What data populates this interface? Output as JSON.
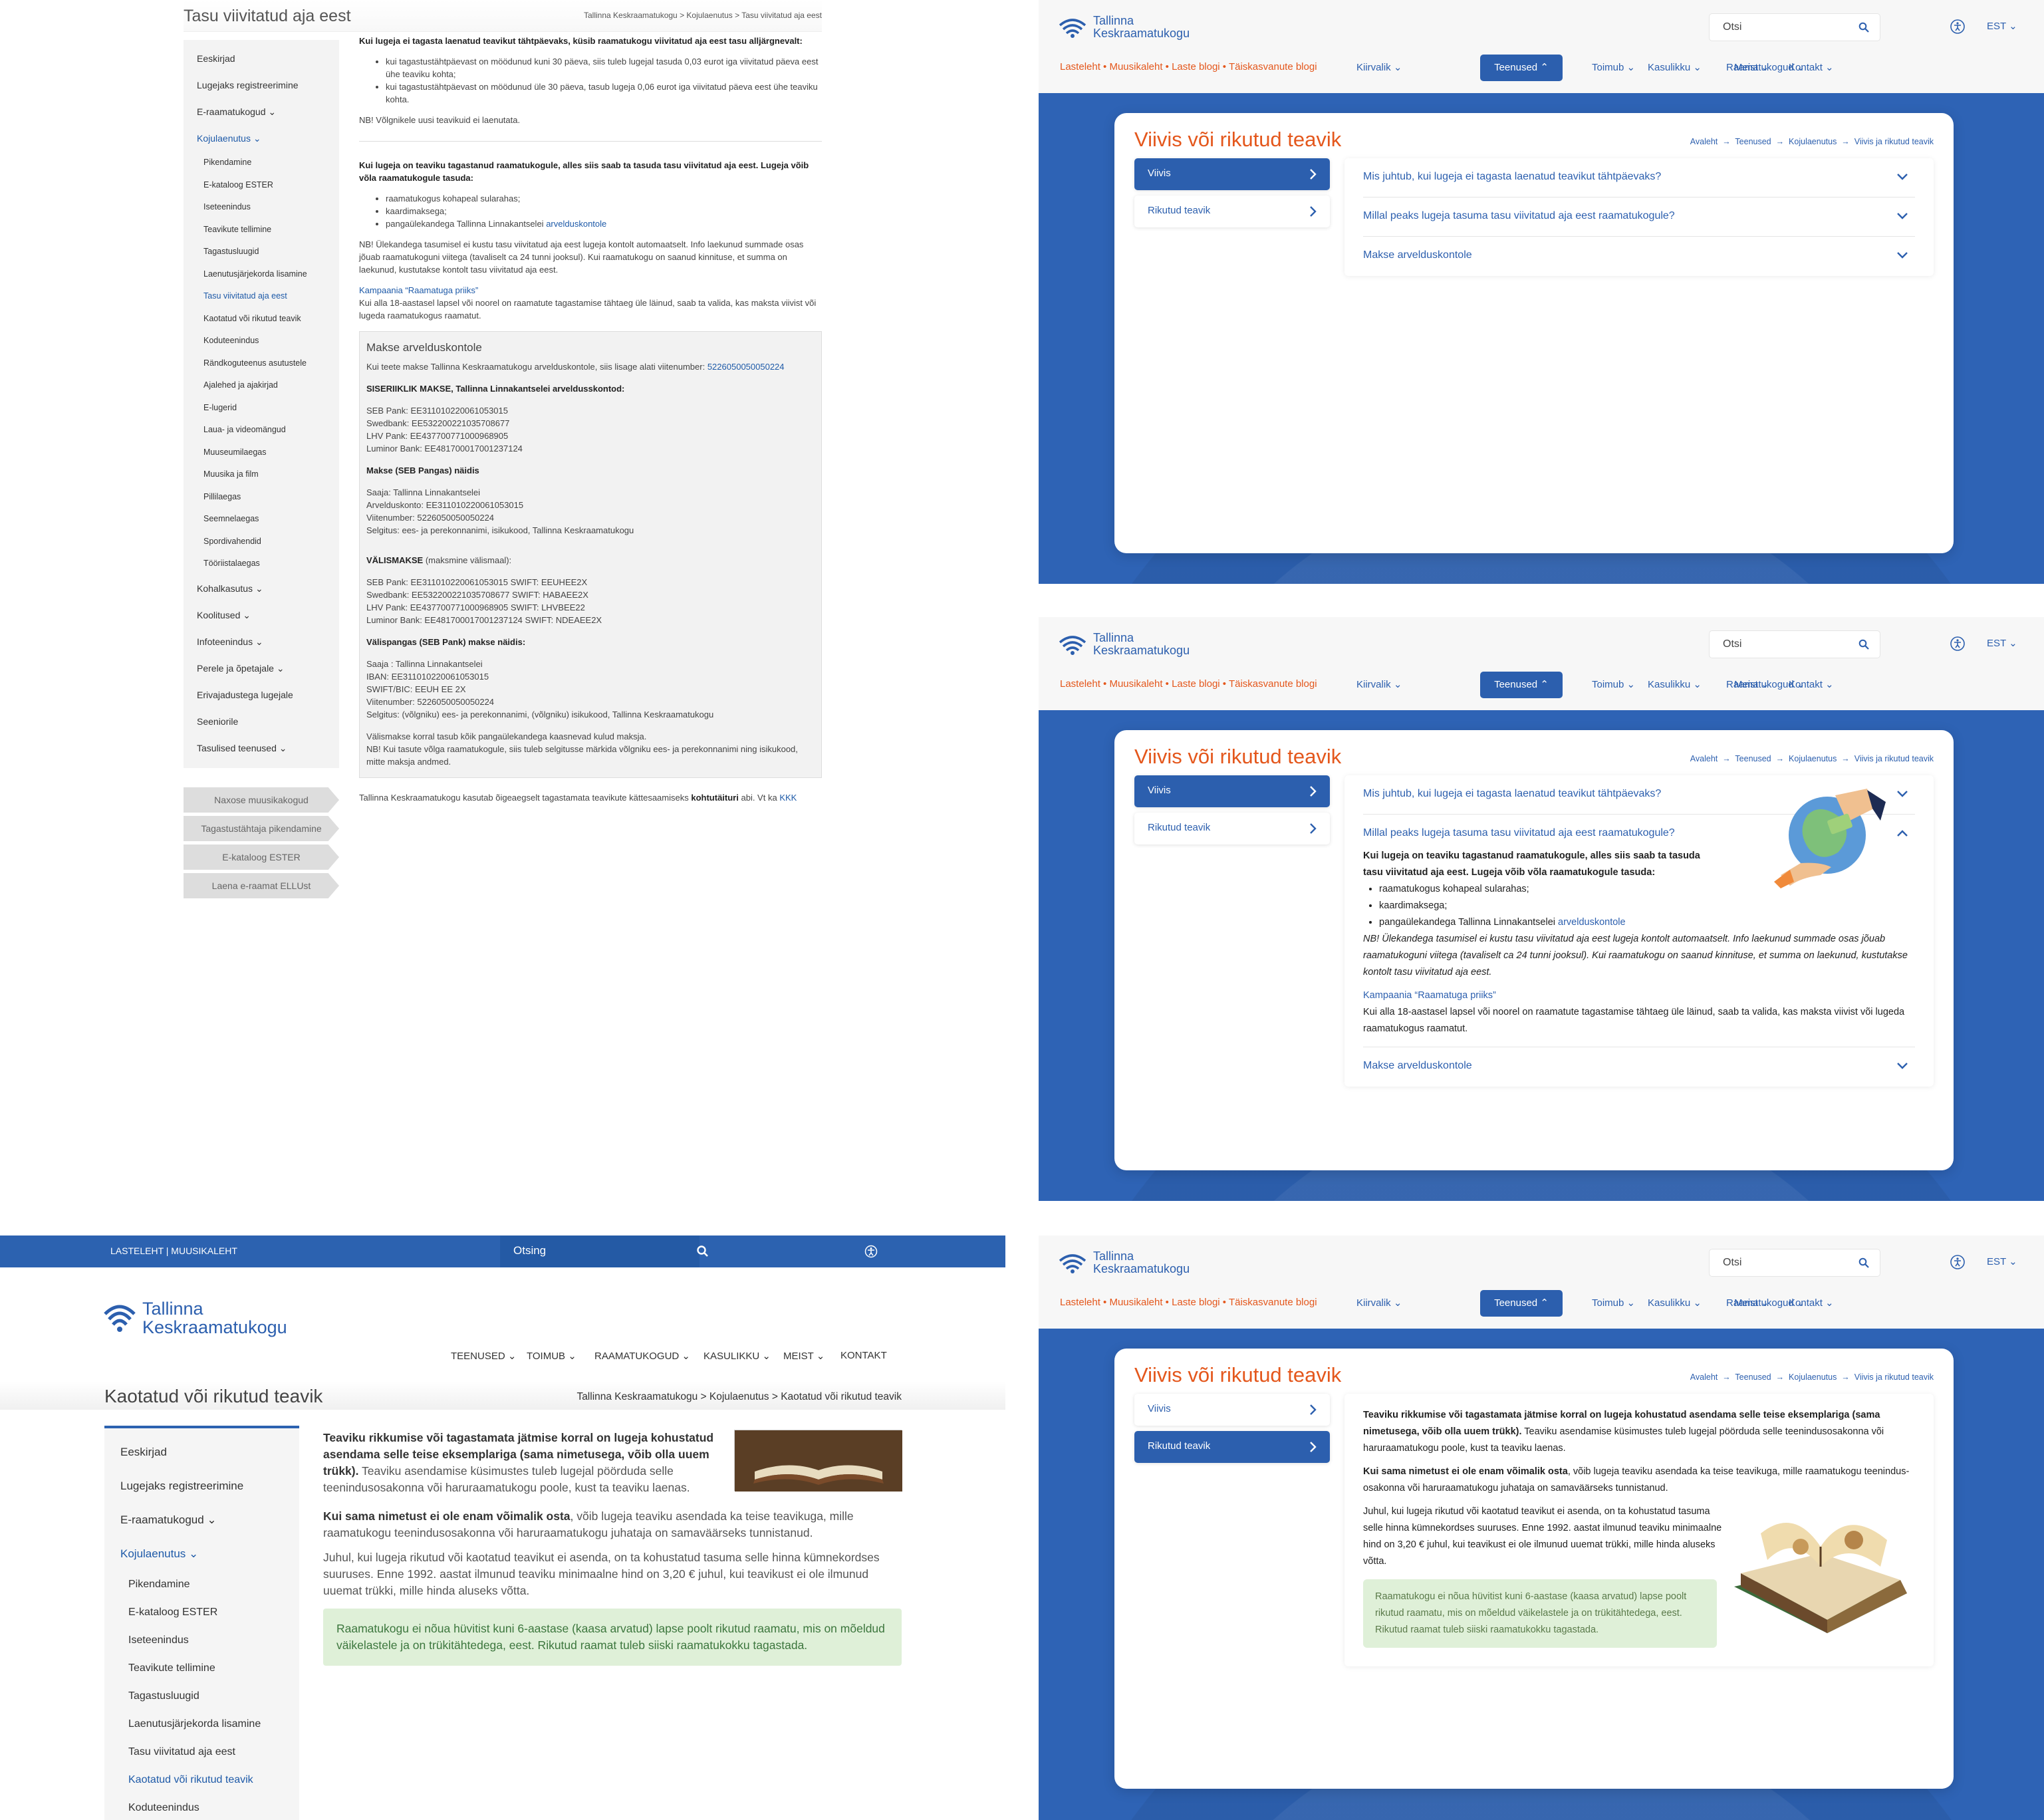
{
  "q1": {
    "title": "Tasu viivitatud aja eest",
    "crumb": "Tallinna Keskraamatukogu > Kojulaenutus > Tasu viivitatud aja eest",
    "side_items": [
      {
        "t": "Eeskirjad",
        "k": "it"
      },
      {
        "t": "Lugejaks registreerimine",
        "k": "it"
      },
      {
        "t": "E-raamatukogud ⌄",
        "k": "it"
      },
      {
        "t": "Kojulaenutus ⌄",
        "k": "it act"
      },
      {
        "t": "Pikendamine",
        "k": "sub"
      },
      {
        "t": "E-kataloog ESTER",
        "k": "sub"
      },
      {
        "t": "Iseteenindus",
        "k": "sub"
      },
      {
        "t": "Teavikute tellimine",
        "k": "sub"
      },
      {
        "t": "Tagastusluugid",
        "k": "sub"
      },
      {
        "t": "Laenutusjärjekorda lisamine",
        "k": "sub"
      },
      {
        "t": "Tasu viivitatud aja eest",
        "k": "sub act"
      },
      {
        "t": "Kaotatud või rikutud teavik",
        "k": "sub"
      },
      {
        "t": "Koduteenindus",
        "k": "sub"
      },
      {
        "t": "Rändkoguteenus asutustele",
        "k": "sub"
      },
      {
        "t": "Ajalehed ja ajakirjad",
        "k": "sub"
      },
      {
        "t": "E-lugerid",
        "k": "sub"
      },
      {
        "t": "Laua- ja videomängud",
        "k": "sub"
      },
      {
        "t": "Muuseumilaegas",
        "k": "sub"
      },
      {
        "t": "Muusika ja film",
        "k": "sub"
      },
      {
        "t": "Pillilaegas",
        "k": "sub"
      },
      {
        "t": "Seemnelaegas",
        "k": "sub"
      },
      {
        "t": "Spordivahendid",
        "k": "sub"
      },
      {
        "t": "Tööriistalaegas",
        "k": "sub"
      },
      {
        "t": "Kohalkasutus ⌄",
        "k": "it"
      },
      {
        "t": "Koolitused ⌄",
        "k": "it"
      },
      {
        "t": "Infoteenindus ⌄",
        "k": "it"
      },
      {
        "t": "Perele ja õpetajale ⌄",
        "k": "it"
      },
      {
        "t": "Erivajadustega lugejale",
        "k": "it"
      },
      {
        "t": "Seeniorile",
        "k": "it"
      },
      {
        "t": "Tasulised teenused ⌄",
        "k": "it"
      }
    ],
    "side_buttons": [
      "Naxose muusikakogud",
      "Tagastustähtaja pikendamine",
      "E-kataloog ESTER",
      "Laena e-raamat ELLUst"
    ],
    "p1": "Kui lugeja ei tagasta laenatud teavikut tähtpäevaks, küsib raamatukogu viivitatud aja eest tasu alljärgnevalt:",
    "li1": "kui tagastustähtpäevast on möödunud kuni 30 päeva, siis tuleb lugejal tasuda 0,03 eurot iga viivitatud päeva eest ühe teaviku kohta;",
    "li2": "kui tagastustähtpäevast on möödunud üle 30 päeva, tasub lugeja 0,06 eurot iga viivitatud päeva eest ühe teaviku kohta.",
    "nb1": "NB! Võlgnikele uusi teavikuid ei laenutata.",
    "p2": "Kui lugeja on teaviku tagastanud raamatukogule, alles siis saab ta tasuda tasu viivitatud aja eest. Lugeja võib võla raamatukogule tasuda:",
    "li3": "raamatukogus kohapeal sularahas;",
    "li4": "kaardimaksega;",
    "li5": "pangaülekandega Tallinna Linnakantselei",
    "li5_link": "arvelduskontole",
    "nb2": "NB! Ülekandega tasumisel ei kustu tasu viivitatud aja eest lugeja kontolt automaatselt. Info laekunud summade osas jõuab raamatukoguni viitega (tavaliselt ca 24 tunni jooksul). Kui raamatukogu on saanud kinnituse, et summa on laekunud, kustutakse kontolt tasu viivitatud aja eest.",
    "camp_link": "Kampaania “Raamatuga priiks”",
    "camp": "Kui alla 18-aastasel lapsel või noorel on raamatute tagastamise tähtaeg üle läinud, saab ta valida, kas maksta viivist või lugeda raamatukogus raamatut.",
    "box_title": "Makse arvelduskontole",
    "box_intro": "Kui teete makse Tallinna Keskraamatukogu arvelduskontole, siis lisage alati viitenumber:",
    "box_ref": "5226050050050224",
    "box_h1": "SISERIIKLIK MAKSE, Tallinna Linnakantselei arveldusskontod:",
    "box_b1": [
      "SEB Pank: EE311010220061053015",
      "Swedbank: EE532200221035708677",
      "LHV Pank: EE437700771000968905",
      "Luminor Bank: EE481700017001237124"
    ],
    "box_h2": "Makse (SEB Pangas) näidis",
    "box_b2": [
      "Saaja: Tallinna Linnakantselei",
      "Arvelduskonto: EE311010220061053015",
      "Viitenumber: 5226050050050224",
      "Selgitus: ees- ja perekonnanimi, isikukood, Tallinna Keskraamatukogu"
    ],
    "box_h3": "VÄLISMAKSE",
    "box_h3b": " (maksmine välismaal):",
    "box_b3": [
      "SEB Pank: EE311010220061053015 SWIFT: EEUHEE2X",
      "Swedbank: EE532200221035708677 SWIFT: HABAEE2X",
      "LHV Pank: EE437700771000968905 SWIFT: LHVBEE22",
      "Luminor Bank: EE481700017001237124 SWIFT: NDEAEE2X"
    ],
    "box_h4": "Välispangas (SEB Pank) makse näidis:",
    "box_b4": [
      "Saaja : Tallinna Linnakantselei",
      "IBAN: EE311010220061053015",
      "SWIFT/BIC: EEUH EE 2X",
      "Viitenumber: 5226050050050224",
      "Selgitus: (võlgniku)  ees- ja perekonnanimi, (võlgniku) isikukood, Tallinna Keskraamatukogu"
    ],
    "box_b5": [
      "Välismakse korral tasub kõik pangaülekandega kaasnevad kulud maksja.",
      "NB! Kui tasute võlga raamatukogule, siis tuleb selgitusse märkida võlgniku ees- ja perekonnanimi ning isikukood, mitte maksja andmed."
    ],
    "foot": "Tallinna Keskraamatukogu kasutab õigeaegselt tagastamata teavikute kättesaamiseks",
    "foot_b": "kohtutäituri",
    "foot2": "abi. Vt ka",
    "foot_link": "KKK"
  },
  "site": {
    "logo": [
      "Tallinna",
      "Keskraamatukogu"
    ],
    "search": "Otsi",
    "lang": "EST ⌄",
    "links": "Lasteleht • Muusikaleht • Laste blogi • Täiskasvanute blogi",
    "nav": [
      "Kiirvalik ⌄",
      "Teenused ⌃",
      "Toimub ⌄",
      "Kasulikku ⌄",
      "Raamatukogud ⌄",
      "Meist ⌄",
      "Kontakt ⌄"
    ],
    "title": "Viivis või rikutud teavik",
    "crumb": [
      "Avaleht",
      "Teenused",
      "Kojulaenutus",
      "Viivis ja rikutud teavik"
    ],
    "tabs": [
      "Viivis",
      "Rikutud teavik"
    ],
    "q": [
      "Mis juhtub, kui lugeja ei tagasta laenatud teavikut tähtpäevaks?",
      "Millal peaks lugeja tasuma tasu viivitatud aja eest raamatukogule?",
      "Makse arvelduskontole"
    ]
  },
  "q3": {
    "p_b": "Kui lugeja on teaviku tagastanud raamatukogule, alles siis saab ta tasuda tasu viivitatud aja eest. Lugeja võib võla raamatukogule tasuda:",
    "li1": "raamatukogus kohapeal sularahas;",
    "li2": "kaardimaksega;",
    "li3": "pangaülekandega Tallinna Linnakantselei",
    "li3_link": "arvelduskontole",
    "nb": "NB! Ülekandega tasumisel ei kustu tasu viivitatud aja eest lugeja kontolt automaatselt. Info laekunud summade osas jõuab raamatukoguni viitega (tavaliselt ca 24 tunni jooksul). Kui raamatukogu on saanud kinnituse, et summa on laekunud, kustutakse kontolt tasu viivitatud aja eest.",
    "camp_link": "Kampaania “Raamatuga priiks”",
    "camp": "Kui alla 18-aastasel lapsel või noorel on raamatute tagastamise tähtaeg üle läinud, saab ta valida, kas maksta viivist või lugeda raamatukogus raamatut."
  },
  "q4": {
    "top": "LASTELEHT  |  MUUSIKALEHT",
    "search": "Otsing",
    "logo": [
      "Tallinna",
      "Keskraamatukogu"
    ],
    "nav": [
      "TEENUSED ⌄",
      "TOIMUB ⌄",
      "RAAMATUKOGUD ⌄",
      "KASULIKKU ⌄",
      "MEIST ⌄",
      "KONTAKT"
    ],
    "title": "Kaotatud või rikutud teavik",
    "crumb": "Tallinna Keskraamatukogu > Kojulaenutus > Kaotatud või rikutud teavik",
    "side": [
      {
        "t": "Eeskirjad",
        "k": "it"
      },
      {
        "t": "Lugejaks registreerimine",
        "k": "it"
      },
      {
        "t": "E-raamatukogud ⌄",
        "k": "it"
      },
      {
        "t": "Kojulaenutus ⌄",
        "k": "it act"
      },
      {
        "t": "Pikendamine",
        "k": "sub"
      },
      {
        "t": "E-kataloog ESTER",
        "k": "sub"
      },
      {
        "t": "Iseteenindus",
        "k": "sub"
      },
      {
        "t": "Teavikute tellimine",
        "k": "sub"
      },
      {
        "t": "Tagastusluugid",
        "k": "sub"
      },
      {
        "t": "Laenutusjärjekorda lisamine",
        "k": "sub"
      },
      {
        "t": "Tasu viivitatud aja eest",
        "k": "sub"
      },
      {
        "t": "Kaotatud või rikutud teavik",
        "k": "sub act"
      },
      {
        "t": "Koduteenindus",
        "k": "sub"
      }
    ],
    "p1b": "Teaviku rikkumise või tagastamata jätmise korral on lugeja kohustatud asendama selle teise eksemplariga (sama nimetusega, võib olla uuem trükk).",
    "p1": " Teaviku asendamise küsimustes tuleb lugejal pöörduda selle teenindusosakonna või haruraamatukogu poole, kust ta teaviku laenas.",
    "p2b": "Kui sama nimetust ei ole enam võimalik osta",
    "p2": ", võib lugeja teaviku asendada ka teise teavikuga, mille raamatukogu teenindusosakonna või haruraamatukogu juhataja on samaväärseks tunnistanud.",
    "p3": "Juhul, kui lugeja rikutud või kaotatud teavikut ei asenda, on ta kohustatud tasuma selle hinna kümnekordses suuruses. Enne 1992. aastat ilmunud teaviku minimaalne hind on 3,20 € juhul, kui teavikust ei ole ilmunud uuemat trükki, mille hinda aluseks võtta.",
    "note": "Raamatukogu ei nõua hüvitist kuni 6-aastase (kaasa arvatud) lapse poolt rikutud raamatu, mis on mõeldud väikelastele ja on trükitähtedega, eest. Rikutud raamat tuleb siiski raamatukokku tagastada."
  },
  "q5": {
    "p1b": "Teaviku rikkumise või tagastamata jätmise korral on lugeja kohustatud asendama selle teise eksemplariga (sama nimetusega, võib olla uuem trükk).",
    "p1": " Teaviku asendamise küsimustes tuleb lugejal pöörduda selle teenindusosakonna või haruraamatukogu poole, kust ta teaviku laenas.",
    "p2b": "Kui sama nimetust ei ole enam võimalik osta",
    "p2": ", võib lugeja teaviku asendada ka teise teavikuga, mille raamatukogu teenindus- osakonna või haruraamatukogu juhataja on samaväärseks tunnistanud.",
    "p3": "Juhul, kui lugeja rikutud või kaotatud teavikut ei asenda, on ta kohustatud tasuma selle hinna kümnekordses suuruses. Enne 1992. aastat ilmunud teaviku minimaalne hind on 3,20 € juhul, kui teavikust ei ole ilmunud uuemat trükki, mille hinda aluseks võtta.",
    "note": "Raamatukogu ei nõua hüvitist kuni 6-aastase (kaasa arvatud) lapse poolt rikutud raamatu, mis on mõeldud väikelastele ja on trükitähtedega, eest. Rikutud raamat tuleb siiski raamatukokku tagastada."
  }
}
